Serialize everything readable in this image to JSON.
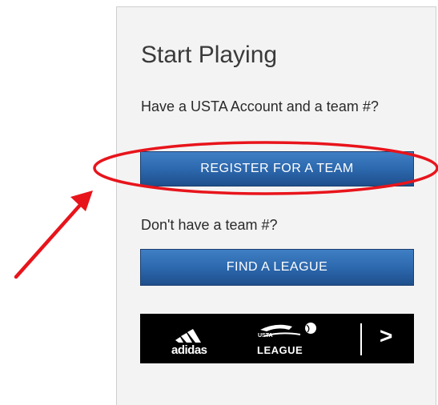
{
  "panel": {
    "title": "Start Playing",
    "prompt_account": "Have a USTA Account and a team #?",
    "register_button": "REGISTER FOR A TEAM",
    "prompt_no_team": "Don't have a team #?",
    "find_league_button": "FIND A LEAGUE"
  },
  "banner": {
    "brand_text": "adidas",
    "league_small": "USTA",
    "league_text": "LEAGUE",
    "chevron": ">"
  },
  "annotation": {
    "circle_color": "#e8141b",
    "arrow_color": "#e8141b"
  },
  "icons": [
    "adidas-logo-icon",
    "usta-league-logo-icon",
    "chevron-right-icon",
    "red-arrow-icon"
  ]
}
